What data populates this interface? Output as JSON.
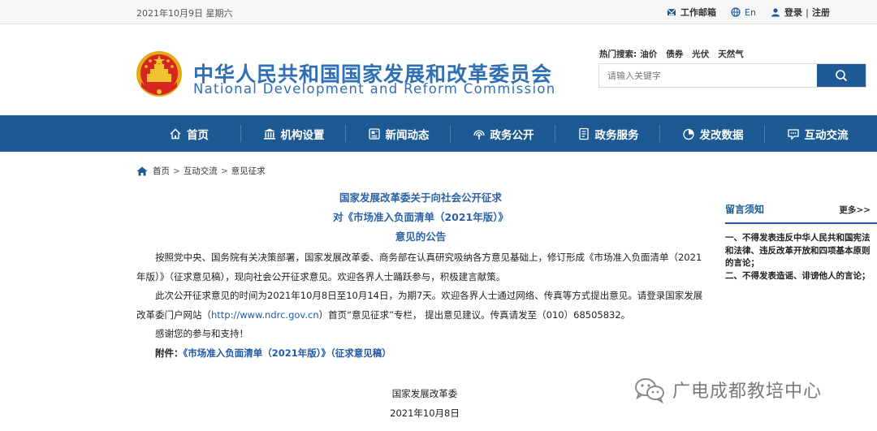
{
  "topbar": {
    "date": "2021年10月9日 星期六",
    "mailbox": "工作邮箱",
    "english": "En",
    "login": "登录",
    "sep": "|",
    "register": "注册"
  },
  "header": {
    "title_cn": "中华人民共和国国家发展和改革委员会",
    "title_en": "National Development and Reform Commission",
    "hot_label": "热门搜索:",
    "hot_terms": [
      "油价",
      "债券",
      "光伏",
      "天然气"
    ],
    "search_placeholder": "请输入关键字"
  },
  "nav": {
    "items": [
      {
        "label": "首页",
        "icon": "home-icon"
      },
      {
        "label": "机构设置",
        "icon": "building-icon"
      },
      {
        "label": "新闻动态",
        "icon": "news-icon"
      },
      {
        "label": "政务公开",
        "icon": "broadcast-icon"
      },
      {
        "label": "政务服务",
        "icon": "document-icon"
      },
      {
        "label": "发改数据",
        "icon": "pie-chart-icon"
      },
      {
        "label": "互动交流",
        "icon": "chat-icon"
      }
    ]
  },
  "breadcrumb": {
    "home": "首页",
    "level1": "互动交流",
    "level2": "意见征求",
    "sep": ">"
  },
  "article": {
    "title_line1": "国家发展改革委关于向社会公开征求",
    "title_line2": "对《市场准入负面清单（2021年版）》",
    "title_line3": "意见的公告",
    "para1": "按照党中央、国务院有关决策部署，国家发展改革委、商务部在认真研究吸纳各方意见基础上，修订形成《市场准入负面清单（2021年版）》（征求意见稿），现向社会公开征求意见。欢迎各界人士踊跃参与，积极建言献策。",
    "para2_a": "此次公开征求意见的时间为2021年10月8日至10月14日，为期7天。欢迎各界人士通过网络、传真等方式提出意见。请登录国家发展改革委门户网站（",
    "para2_link": "http://www.ndrc.gov.cn",
    "para2_b": "）首页“意见征求”专栏， 提出意见建议。传真请发至（010）68505832。",
    "para3": "感谢您的参与和支持！",
    "attach_label": "附件：",
    "attach_link": "《市场准入负面清单（2021年版）》（征求意见稿）",
    "sign_org": "国家发展改革委",
    "sign_date": "2021年10月8日"
  },
  "side": {
    "title": "留言须知",
    "more": "更多>>",
    "notes": [
      "一、不得发表违反中华人民共和国宪法和法律、违反改革开放和四项基本原则的言论；",
      "二、不得发表造谣、诽谤他人的言论；"
    ]
  },
  "watermark": {
    "text": "广电成都教培中心"
  },
  "colors": {
    "nav_bg": "#1d5a93",
    "title_blue": "#2f6fb6",
    "link_blue": "#1f59a8"
  }
}
